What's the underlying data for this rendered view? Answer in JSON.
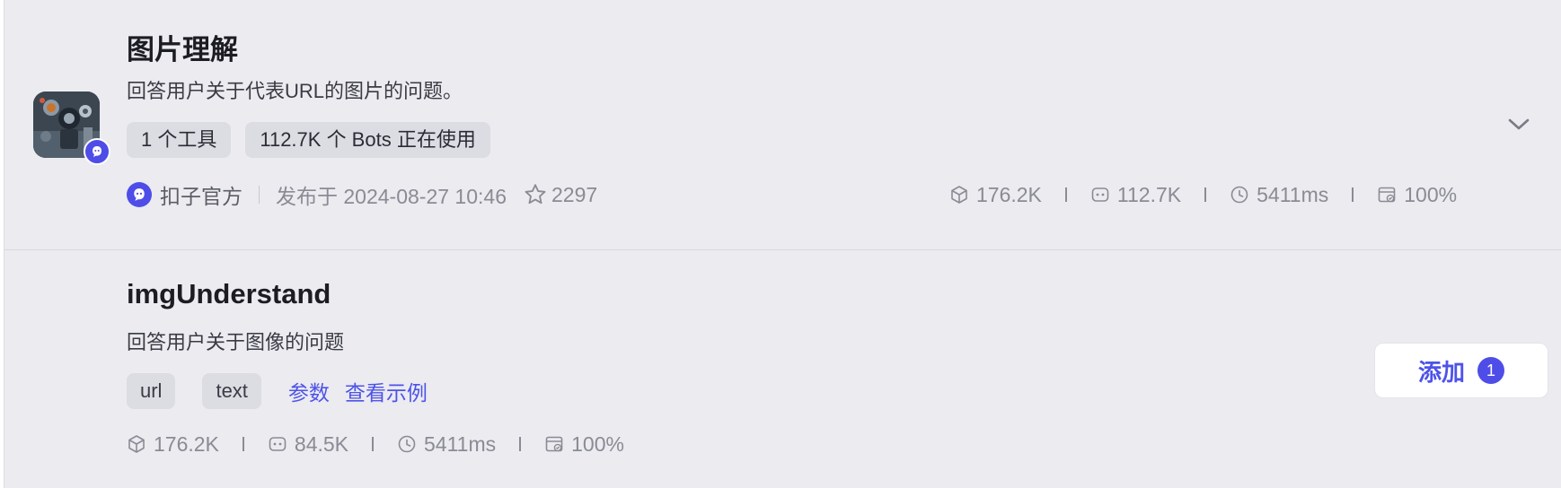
{
  "plugin": {
    "title": "图片理解",
    "description": "回答用户关于代表URL的图片的问题。",
    "tags": [
      "1 个工具",
      "112.7K 个 Bots 正在使用"
    ],
    "author": "扣子官方",
    "published": "发布于 2024-08-27 10:46",
    "favorites": "2297",
    "stats": {
      "calls": "176.2K",
      "bots": "112.7K",
      "latency": "5411ms",
      "success_rate": "100%"
    },
    "icons": {
      "avatar": "robot-avatar-image",
      "official_badge": "official-badge-icon",
      "expand": "chevron-down-icon",
      "favorites": "star-icon",
      "calls": "cube-icon",
      "bots": "bot-icon",
      "latency": "clock-icon",
      "success_rate": "success-rate-icon"
    }
  },
  "tool": {
    "name": "imgUnderstand",
    "description": "回答用户关于图像的问题",
    "params": [
      "url",
      "text"
    ],
    "params_link": "参数",
    "example_link": "查看示例",
    "stats": {
      "calls": "176.2K",
      "bots": "84.5K",
      "latency": "5411ms",
      "success_rate": "100%"
    },
    "add_button": {
      "label": "添加",
      "count": "1"
    }
  },
  "colors": {
    "panel_background": "#ebebf0",
    "accent": "#4d53e8",
    "tag_background": "#dcdce3",
    "muted_text": "#8a8b94"
  }
}
